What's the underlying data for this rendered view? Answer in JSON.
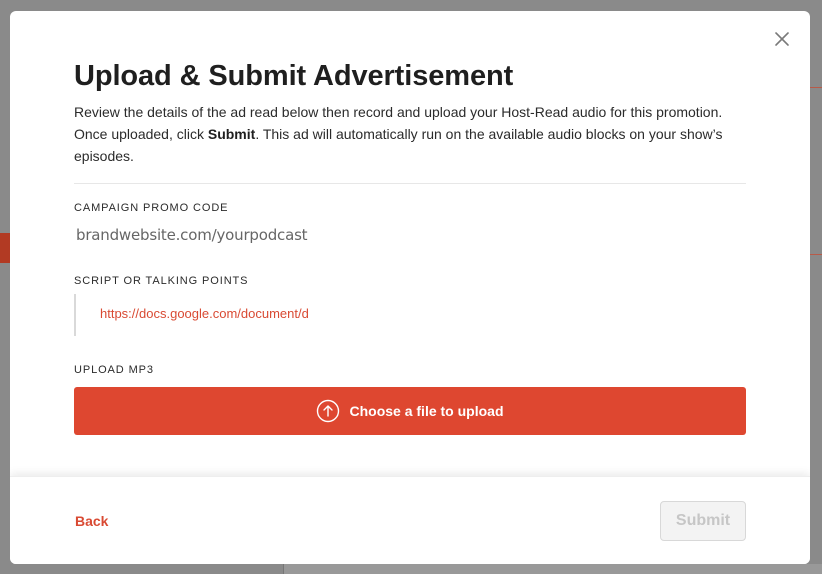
{
  "modal": {
    "title": "Upload & Submit Advertisement",
    "description": {
      "part1": "Review the details of the ad read below then record and upload your Host-Read audio for this promotion. Once uploaded, click ",
      "bold": "Submit",
      "part2": ". This ad will automatically run on the available audio blocks on your show’s episodes."
    },
    "promo": {
      "label": "CAMPAIGN PROMO CODE",
      "value": "brandwebsite.com/yourpodcast"
    },
    "script": {
      "label": "SCRIPT OR TALKING POINTS",
      "link": "https://docs.google.com/document/d"
    },
    "upload": {
      "label": "UPLOAD MP3",
      "button_label": "Choose a file to upload",
      "icon": "upload-arrow-circle-icon"
    },
    "footer": {
      "back_label": "Back",
      "submit_label": "Submit",
      "submit_state": "disabled"
    },
    "close_icon": "close-icon"
  },
  "colors": {
    "accent": "#de4730",
    "link": "#d94a33",
    "overlay": "#8a8a8a"
  }
}
